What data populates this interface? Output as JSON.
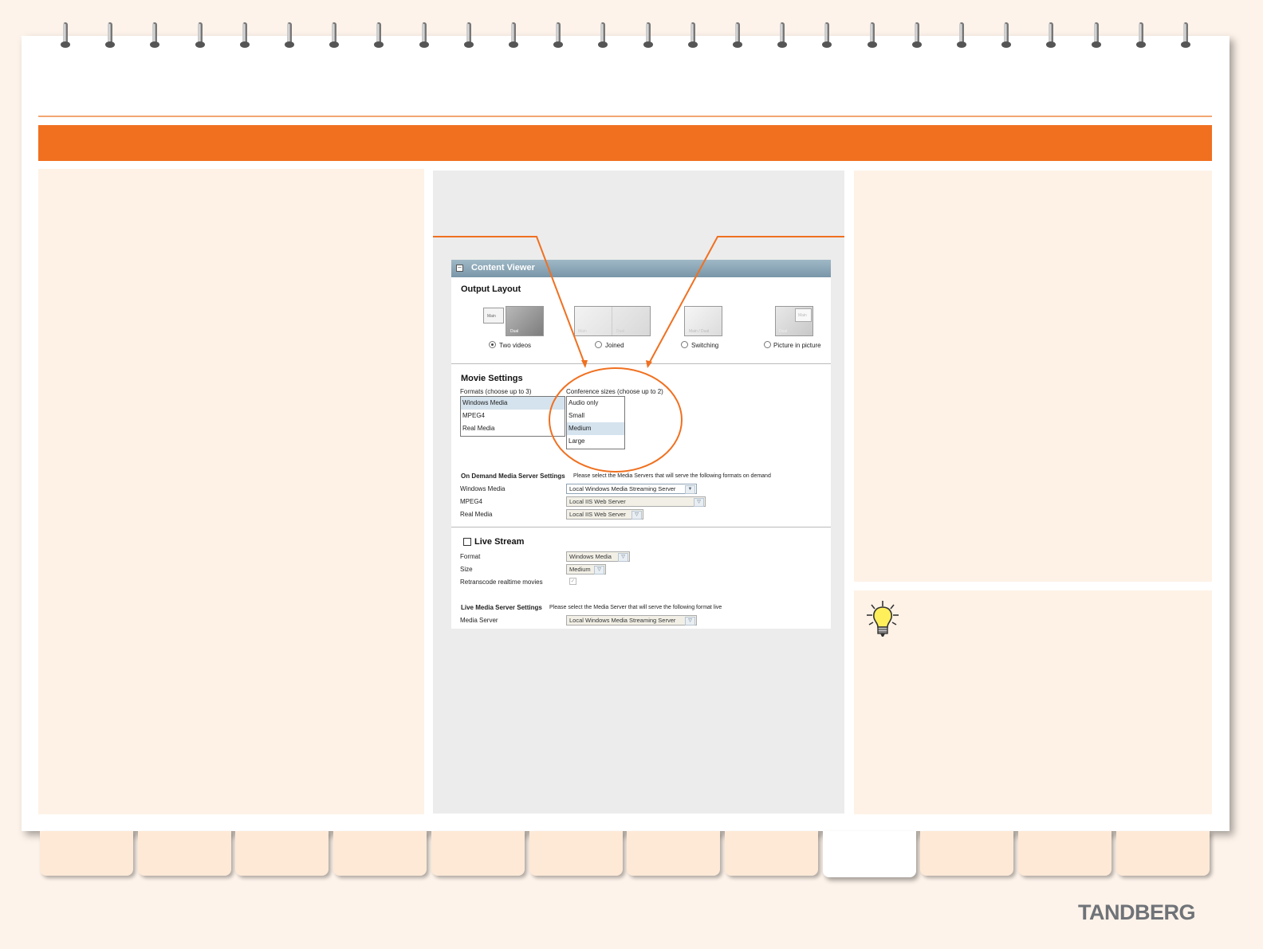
{
  "content_viewer": {
    "header": "Content Viewer",
    "output_layout": {
      "title": "Output Layout",
      "options": [
        {
          "label": "Two videos",
          "thumb_labels": [
            "Main",
            "Dual"
          ],
          "selected": true
        },
        {
          "label": "Joined",
          "thumb_labels": [
            "Main",
            "Dual"
          ],
          "selected": false
        },
        {
          "label": "Switching",
          "thumb_labels": [
            "Main / Dual"
          ],
          "selected": false
        },
        {
          "label": "Picture in picture",
          "thumb_labels": [
            "Main",
            "Dual"
          ],
          "selected": false
        }
      ]
    },
    "movie_settings": {
      "title": "Movie Settings",
      "formats_label": "Formats (choose up to 3)",
      "formats": [
        "Windows Media",
        "MPEG4",
        "Real Media"
      ],
      "sizes_label": "Conference sizes (choose up to 2)",
      "sizes": [
        "Audio only",
        "Small",
        "Medium",
        "Large"
      ]
    },
    "on_demand": {
      "title": "On Demand Media Server Settings",
      "hint": "Please select the Media Servers that will serve the following formats on demand",
      "rows": [
        {
          "label": "Windows Media",
          "value": "Local Windows Media Streaming Server"
        },
        {
          "label": "MPEG4",
          "value": "Local IIS Web Server"
        },
        {
          "label": "Real Media",
          "value": "Local IIS Web Server"
        }
      ]
    },
    "live_stream": {
      "title": "Live Stream",
      "format_label": "Format",
      "format_value": "Windows Media",
      "size_label": "Size",
      "size_value": "Medium",
      "retranscode_label": "Retranscode realtime movies"
    },
    "live_server": {
      "title": "Live Media Server Settings",
      "hint": "Please select the Media Server that will serve the following format live",
      "row_label": "Media Server",
      "row_value": "Local Windows Media Streaming Server"
    }
  },
  "brand": {
    "logo": "TANDBERG"
  },
  "colors": {
    "accent": "#f07020",
    "panel": "#fef2e6",
    "logo": "#6f7378"
  }
}
